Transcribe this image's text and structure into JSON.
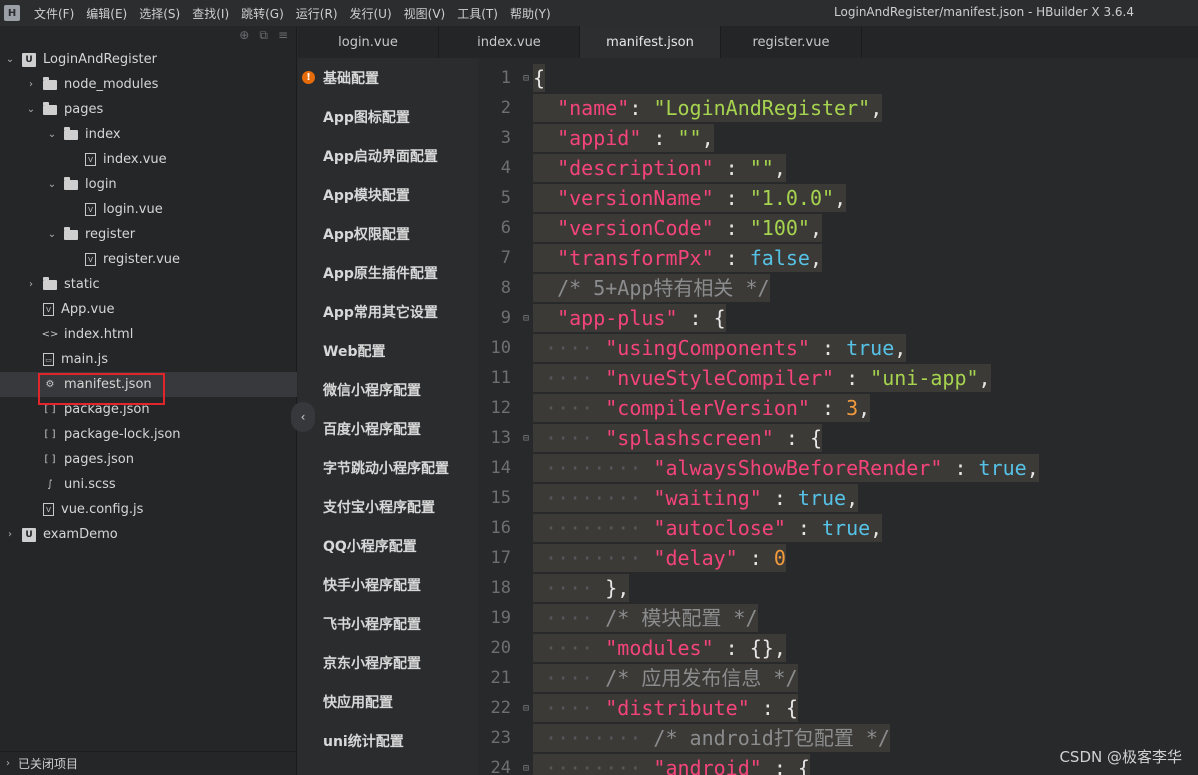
{
  "app": {
    "logo": "H",
    "menu": [
      "文件(F)",
      "编辑(E)",
      "选择(S)",
      "查找(I)",
      "跳转(G)",
      "运行(R)",
      "发行(U)",
      "视图(V)",
      "工具(T)",
      "帮助(Y)"
    ],
    "window_title": "LoginAndRegister/manifest.json - HBuilder X 3.6.4"
  },
  "sidebar": {
    "tree": [
      {
        "label": "LoginAndRegister",
        "depth": 0,
        "chev": "open",
        "icon": "project"
      },
      {
        "label": "node_modules",
        "depth": 1,
        "chev": "closed",
        "icon": "folder"
      },
      {
        "label": "pages",
        "depth": 1,
        "chev": "open",
        "icon": "folder"
      },
      {
        "label": "index",
        "depth": 2,
        "chev": "open",
        "icon": "folder"
      },
      {
        "label": "index.vue",
        "depth": 3,
        "chev": "none",
        "icon": "vue"
      },
      {
        "label": "login",
        "depth": 2,
        "chev": "open",
        "icon": "folder"
      },
      {
        "label": "login.vue",
        "depth": 3,
        "chev": "none",
        "icon": "vue"
      },
      {
        "label": "register",
        "depth": 2,
        "chev": "open",
        "icon": "folder"
      },
      {
        "label": "register.vue",
        "depth": 3,
        "chev": "none",
        "icon": "vue"
      },
      {
        "label": "static",
        "depth": 1,
        "chev": "closed",
        "icon": "folder"
      },
      {
        "label": "App.vue",
        "depth": 1,
        "chev": "none",
        "icon": "vue"
      },
      {
        "label": "index.html",
        "depth": 1,
        "chev": "none",
        "icon": "html"
      },
      {
        "label": "main.js",
        "depth": 1,
        "chev": "none",
        "icon": "js"
      },
      {
        "label": "manifest.json",
        "depth": 1,
        "chev": "none",
        "icon": "gear",
        "selected": true
      },
      {
        "label": "package.json",
        "depth": 1,
        "chev": "none",
        "icon": "json"
      },
      {
        "label": "package-lock.json",
        "depth": 1,
        "chev": "none",
        "icon": "json"
      },
      {
        "label": "pages.json",
        "depth": 1,
        "chev": "none",
        "icon": "json"
      },
      {
        "label": "uni.scss",
        "depth": 1,
        "chev": "none",
        "icon": "scss"
      },
      {
        "label": "vue.config.js",
        "depth": 1,
        "chev": "none",
        "icon": "vue"
      },
      {
        "label": "examDemo",
        "depth": 0,
        "chev": "closed",
        "icon": "project"
      }
    ],
    "footer": "已关闭项目"
  },
  "tabs": [
    {
      "label": "login.vue",
      "active": false
    },
    {
      "label": "index.vue",
      "active": false
    },
    {
      "label": "manifest.json",
      "active": true
    },
    {
      "label": "register.vue",
      "active": false
    }
  ],
  "config_nav": [
    {
      "label": "基础配置",
      "warn": true
    },
    {
      "label": "App图标配置"
    },
    {
      "label": "App启动界面配置"
    },
    {
      "label": "App模块配置"
    },
    {
      "label": "App权限配置"
    },
    {
      "label": "App原生插件配置"
    },
    {
      "label": "App常用其它设置"
    },
    {
      "label": "Web配置"
    },
    {
      "label": "微信小程序配置"
    },
    {
      "label": "百度小程序配置"
    },
    {
      "label": "字节跳动小程序配置"
    },
    {
      "label": "支付宝小程序配置"
    },
    {
      "label": "QQ小程序配置"
    },
    {
      "label": "快手小程序配置"
    },
    {
      "label": "飞书小程序配置"
    },
    {
      "label": "京东小程序配置"
    },
    {
      "label": "快应用配置"
    },
    {
      "label": "uni统计配置"
    }
  ],
  "code_lines": [
    {
      "n": 1,
      "fold": true,
      "indent": 0,
      "tokens": [
        [
          "p",
          "{"
        ]
      ]
    },
    {
      "n": 2,
      "indent": 1,
      "tokens": [
        [
          "k",
          "\"name\""
        ],
        [
          "p",
          ": "
        ],
        [
          "s",
          "\"LoginAndRegister\""
        ],
        [
          "p",
          ","
        ]
      ]
    },
    {
      "n": 3,
      "indent": 1,
      "tokens": [
        [
          "k",
          "\"appid\""
        ],
        [
          "p",
          " : "
        ],
        [
          "s",
          "\"\""
        ],
        [
          "p",
          ","
        ]
      ]
    },
    {
      "n": 4,
      "indent": 1,
      "tokens": [
        [
          "k",
          "\"description\""
        ],
        [
          "p",
          " : "
        ],
        [
          "s",
          "\"\""
        ],
        [
          "p",
          ","
        ]
      ]
    },
    {
      "n": 5,
      "indent": 1,
      "tokens": [
        [
          "k",
          "\"versionName\""
        ],
        [
          "p",
          " : "
        ],
        [
          "s",
          "\"1.0.0\""
        ],
        [
          "p",
          ","
        ]
      ]
    },
    {
      "n": 6,
      "indent": 1,
      "tokens": [
        [
          "k",
          "\"versionCode\""
        ],
        [
          "p",
          " : "
        ],
        [
          "s",
          "\"100\""
        ],
        [
          "p",
          ","
        ]
      ]
    },
    {
      "n": 7,
      "indent": 1,
      "tokens": [
        [
          "k",
          "\"transformPx\""
        ],
        [
          "p",
          " : "
        ],
        [
          "b",
          "false"
        ],
        [
          "p",
          ","
        ]
      ]
    },
    {
      "n": 8,
      "indent": 1,
      "tokens": [
        [
          "c",
          "/* 5+App特有相关 */"
        ]
      ]
    },
    {
      "n": 9,
      "fold": true,
      "indent": 1,
      "tokens": [
        [
          "k",
          "\"app-plus\""
        ],
        [
          "p",
          " : {"
        ]
      ]
    },
    {
      "n": 10,
      "indent": 2,
      "tokens": [
        [
          "k",
          "\"usingComponents\""
        ],
        [
          "p",
          " : "
        ],
        [
          "b",
          "true"
        ],
        [
          "p",
          ","
        ]
      ]
    },
    {
      "n": 11,
      "indent": 2,
      "tokens": [
        [
          "k",
          "\"nvueStyleCompiler\""
        ],
        [
          "p",
          " : "
        ],
        [
          "s",
          "\"uni-app\""
        ],
        [
          "p",
          ","
        ]
      ]
    },
    {
      "n": 12,
      "indent": 2,
      "tokens": [
        [
          "k",
          "\"compilerVersion\""
        ],
        [
          "p",
          " : "
        ],
        [
          "n",
          "3"
        ],
        [
          "p",
          ","
        ]
      ]
    },
    {
      "n": 13,
      "fold": true,
      "indent": 2,
      "tokens": [
        [
          "k",
          "\"splashscreen\""
        ],
        [
          "p",
          " : {"
        ]
      ]
    },
    {
      "n": 14,
      "indent": 3,
      "tokens": [
        [
          "k",
          "\"alwaysShowBeforeRender\""
        ],
        [
          "p",
          " : "
        ],
        [
          "b",
          "true"
        ],
        [
          "p",
          ","
        ]
      ]
    },
    {
      "n": 15,
      "indent": 3,
      "tokens": [
        [
          "k",
          "\"waiting\""
        ],
        [
          "p",
          " : "
        ],
        [
          "b",
          "true"
        ],
        [
          "p",
          ","
        ]
      ]
    },
    {
      "n": 16,
      "indent": 3,
      "tokens": [
        [
          "k",
          "\"autoclose\""
        ],
        [
          "p",
          " : "
        ],
        [
          "b",
          "true"
        ],
        [
          "p",
          ","
        ]
      ]
    },
    {
      "n": 17,
      "indent": 3,
      "tokens": [
        [
          "k",
          "\"delay\""
        ],
        [
          "p",
          " : "
        ],
        [
          "n",
          "0"
        ]
      ]
    },
    {
      "n": 18,
      "indent": 2,
      "tokens": [
        [
          "p",
          "},"
        ]
      ]
    },
    {
      "n": 19,
      "indent": 2,
      "tokens": [
        [
          "c",
          "/* 模块配置 */"
        ]
      ]
    },
    {
      "n": 20,
      "indent": 2,
      "tokens": [
        [
          "k",
          "\"modules\""
        ],
        [
          "p",
          " : {},"
        ]
      ]
    },
    {
      "n": 21,
      "indent": 2,
      "tokens": [
        [
          "c",
          "/* 应用发布信息 */"
        ]
      ]
    },
    {
      "n": 22,
      "fold": true,
      "indent": 2,
      "tokens": [
        [
          "k",
          "\"distribute\""
        ],
        [
          "p",
          " : {"
        ]
      ]
    },
    {
      "n": 23,
      "indent": 3,
      "tokens": [
        [
          "c",
          "/* android打包配置 */"
        ]
      ]
    },
    {
      "n": 24,
      "fold": true,
      "indent": 3,
      "tokens": [
        [
          "k",
          "\"android\""
        ],
        [
          "p",
          " : {"
        ]
      ]
    }
  ],
  "watermark": "CSDN @极客李华"
}
